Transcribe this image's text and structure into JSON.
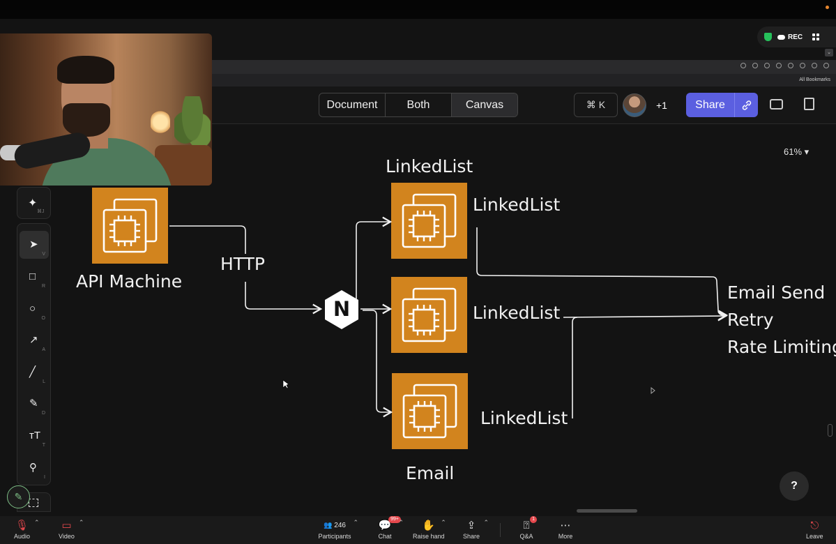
{
  "status": {
    "rec_label": "REC"
  },
  "browser": {
    "bookmarks_label": "All Bookmarks"
  },
  "header": {
    "view_modes": [
      "Document",
      "Both",
      "Canvas"
    ],
    "command_shortcut": "⌘ K",
    "collaborators_extra": "+1",
    "share_label": "Share"
  },
  "canvas": {
    "zoom": "61%",
    "labels": {
      "api_machine": "API Machine",
      "http": "HTTP",
      "top_title": "LinkedList",
      "top_side": "LinkedList",
      "mid_side": "LinkedList",
      "bottom_side": "LinkedList",
      "email": "Email",
      "notes": [
        "Email Send",
        "Retry",
        "Rate Limiting"
      ],
      "nginx_letter": "N"
    },
    "colors": {
      "aws_orange": "#d2841e",
      "canvas_bg": "#131313"
    }
  },
  "toolbar": {
    "ai_key": "⌘J",
    "tools": [
      {
        "name": "select",
        "icon": "cursor-icon",
        "key": "V"
      },
      {
        "name": "rectangle",
        "icon": "square-icon",
        "key": "R"
      },
      {
        "name": "ellipse",
        "icon": "circle-icon",
        "key": "O"
      },
      {
        "name": "arrow",
        "icon": "arrow-icon",
        "key": "A"
      },
      {
        "name": "line",
        "icon": "line-icon",
        "key": "L"
      },
      {
        "name": "draw",
        "icon": "pencil-icon",
        "key": "D"
      },
      {
        "name": "text",
        "icon": "text-icon",
        "key": "T"
      },
      {
        "name": "image",
        "icon": "image-search-icon",
        "key": "I"
      }
    ]
  },
  "help": {
    "label": "?"
  },
  "zoom_meeting": {
    "audio": "Audio",
    "video": "Video",
    "participants": "Participants",
    "participants_count": "246",
    "chat": "Chat",
    "chat_badge": "99+",
    "raise_hand": "Raise hand",
    "share": "Share",
    "qa": "Q&A",
    "qa_badge": "1",
    "more": "More",
    "leave": "Leave"
  }
}
